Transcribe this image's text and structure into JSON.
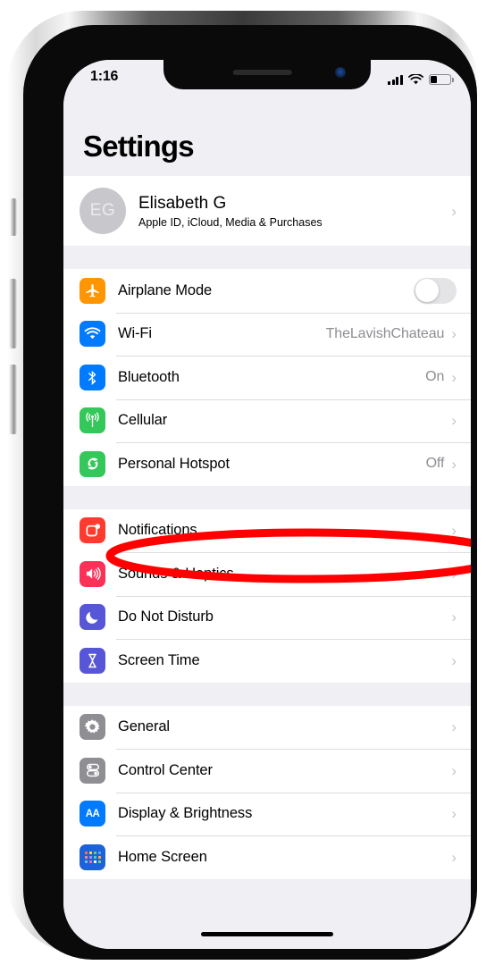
{
  "status_bar": {
    "time": "1:16",
    "signal_icon": "cellular-signal-icon",
    "signal_bars_filled": 4,
    "wifi_icon": "wifi-icon",
    "battery_icon": "battery-icon",
    "battery_level_percent": 35
  },
  "header": {
    "title": "Settings"
  },
  "account": {
    "initials": "EG",
    "name": "Elisabeth G",
    "subtitle": "Apple ID, iCloud, Media & Purchases",
    "chevron": "›"
  },
  "groups": [
    {
      "name": "connectivity",
      "rows": [
        {
          "icon": "airplane-icon",
          "icon_class": "ic-airplane",
          "label": "Airplane Mode",
          "value": "",
          "control": "toggle",
          "toggle_on": false
        },
        {
          "icon": "wifi-icon",
          "icon_class": "ic-wifi",
          "label": "Wi-Fi",
          "value": "TheLavishChateau",
          "control": "chevron"
        },
        {
          "icon": "bluetooth-icon",
          "icon_class": "ic-bluetooth",
          "label": "Bluetooth",
          "value": "On",
          "control": "chevron"
        },
        {
          "icon": "cellular-icon",
          "icon_class": "ic-cellular",
          "label": "Cellular",
          "value": "",
          "control": "chevron"
        },
        {
          "icon": "hotspot-icon",
          "icon_class": "ic-hotspot",
          "label": "Personal Hotspot",
          "value": "Off",
          "control": "chevron",
          "highlighted": true
        }
      ]
    },
    {
      "name": "alerts",
      "rows": [
        {
          "icon": "notifications-icon",
          "icon_class": "ic-notif",
          "label": "Notifications",
          "value": "",
          "control": "chevron"
        },
        {
          "icon": "speaker-icon",
          "icon_class": "ic-sounds",
          "label": "Sounds & Haptics",
          "value": "",
          "control": "chevron"
        },
        {
          "icon": "moon-icon",
          "icon_class": "ic-dnd",
          "label": "Do Not Disturb",
          "value": "",
          "control": "chevron"
        },
        {
          "icon": "hourglass-icon",
          "icon_class": "ic-screentime",
          "label": "Screen Time",
          "value": "",
          "control": "chevron"
        }
      ]
    },
    {
      "name": "system",
      "rows": [
        {
          "icon": "gear-icon",
          "icon_class": "ic-general",
          "label": "General",
          "value": "",
          "control": "chevron"
        },
        {
          "icon": "sliders-icon",
          "icon_class": "ic-control",
          "label": "Control Center",
          "value": "",
          "control": "chevron"
        },
        {
          "icon": "aa-text-icon",
          "icon_class": "ic-display",
          "label": "Display & Brightness",
          "value": "",
          "control": "chevron"
        },
        {
          "icon": "app-grid-icon",
          "icon_class": "ic-homescreen",
          "label": "Home Screen",
          "value": "",
          "control": "chevron"
        }
      ]
    }
  ],
  "annotation": {
    "shape": "ellipse-highlight",
    "color": "#ff0000",
    "target": "Personal Hotspot"
  },
  "colors": {
    "accent_blue": "#007aff",
    "green": "#34c759",
    "orange": "#ff9500",
    "red": "#ff3b30",
    "purple": "#5756d6",
    "grey": "#8e8e93",
    "page_background": "#efeff4",
    "annotation_red": "#ff0000"
  }
}
